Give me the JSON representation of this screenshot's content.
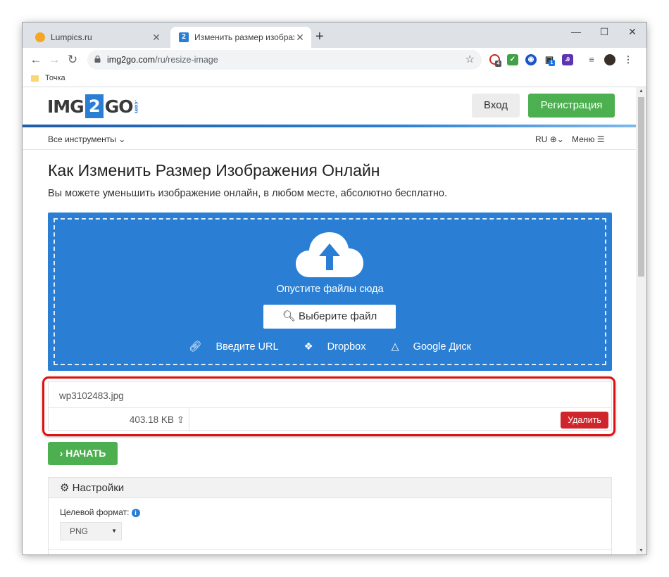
{
  "browser": {
    "tabs": [
      {
        "title": "Lumpics.ru",
        "active": false
      },
      {
        "title": "Изменить размер изображений онлайн",
        "active": true
      }
    ],
    "new_tab": "+",
    "window_controls": {
      "minimize": "—",
      "maximize": "☐",
      "close": "✕"
    },
    "url_host": "img2go.com",
    "url_path": "/ru/resize-image",
    "bookmark": "Точка",
    "extension_badges": {
      "ext1": "4",
      "ext2": "1"
    }
  },
  "site": {
    "logo": {
      "left": "IMG",
      "mid": "2",
      "right": "GO",
      "com": ".com"
    },
    "login": "Вход",
    "register": "Регистрация",
    "all_tools": "Все инструменты",
    "lang": "RU",
    "menu": "Меню"
  },
  "main": {
    "title": "Как Изменить Размер Изображения Онлайн",
    "lead": "Вы можете уменьшить изображение онлайн, в любом месте, абсолютно бесплатно.",
    "dropzone": {
      "drop_text": "Опустите файлы сюда",
      "choose_button": "Выберите файл",
      "url": "Введите URL",
      "dropbox": "Dropbox",
      "gdrive": "Google Диск"
    },
    "file": {
      "name": "wp3102483.jpg",
      "size": "403.18 KB",
      "delete": "Удалить"
    },
    "start_button": "НАЧАТЬ",
    "settings": {
      "title": "Настройки",
      "target_format_label": "Целевой формат:",
      "target_format_value": "PNG"
    }
  },
  "colors": {
    "brand_blue": "#2a7fd4",
    "green": "#4caf50",
    "delete_red": "#d0252b",
    "highlight_red": "#e01010"
  }
}
